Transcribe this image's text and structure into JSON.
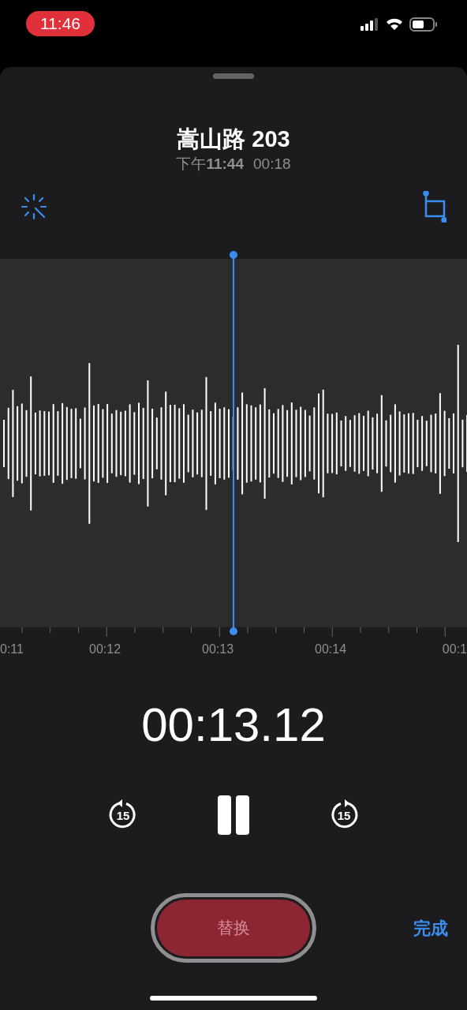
{
  "status_bar": {
    "time": "11:46",
    "recording": true
  },
  "recording": {
    "title": "嵩山路 203",
    "date_prefix": "下午",
    "time": "11:44",
    "duration": "00:18"
  },
  "timeline": {
    "labels": [
      "0:11",
      "00:12",
      "00:13",
      "00:14",
      "00:1"
    ]
  },
  "playback": {
    "position": "00:13.12",
    "skip_back": "15",
    "skip_forward": "15",
    "playing": true
  },
  "replace_button": {
    "label": "替换",
    "disabled": true
  },
  "done_button": {
    "label": "完成"
  }
}
